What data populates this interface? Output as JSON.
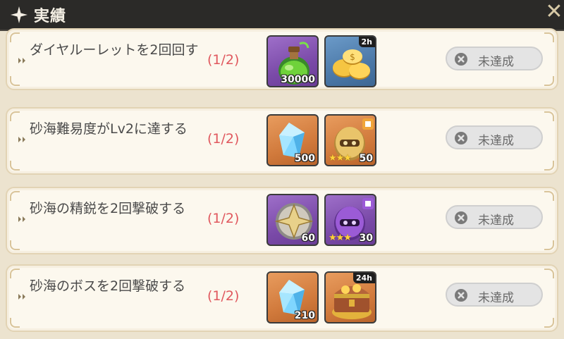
{
  "header": {
    "title": "実績",
    "close_glyph": "✕"
  },
  "achievements": [
    {
      "desc": "ダイヤルーレットを2回回す",
      "progress": "(1/2)",
      "status": "未達成",
      "rewards": [
        {
          "icon": "green-potion-icon",
          "bg": "purple",
          "qty": "30000",
          "time": "",
          "stars": ""
        },
        {
          "icon": "gold-coins-icon",
          "bg": "blue",
          "qty": "",
          "time": "2h",
          "stars": ""
        }
      ]
    },
    {
      "desc": "砂海難易度がLv2に達する",
      "progress": "(1/2)",
      "status": "未達成",
      "rewards": [
        {
          "icon": "blue-crystal-icon",
          "bg": "orange",
          "qty": "500",
          "time": "",
          "stars": ""
        },
        {
          "icon": "gold-helmet-icon",
          "bg": "orange",
          "qty": "50",
          "time": "",
          "stars": "★★★"
        }
      ]
    },
    {
      "desc": "砂海の精鋭を2回撃破する",
      "progress": "(1/2)",
      "status": "未達成",
      "rewards": [
        {
          "icon": "star-medal-icon",
          "bg": "purple",
          "qty": "60",
          "time": "",
          "stars": ""
        },
        {
          "icon": "purple-helmet-icon",
          "bg": "purple",
          "qty": "30",
          "time": "",
          "stars": "★★★"
        }
      ]
    },
    {
      "desc": "砂海のボスを2回撃破する",
      "progress": "(1/2)",
      "status": "未達成",
      "rewards": [
        {
          "icon": "blue-crystal-icon",
          "bg": "orange",
          "qty": "210",
          "time": "",
          "stars": ""
        },
        {
          "icon": "treasure-chest-icon",
          "bg": "orange",
          "qty": "",
          "time": "24h",
          "stars": ""
        }
      ]
    }
  ],
  "colors": {
    "header_bg": "#2b2a28",
    "progress": "#e0585e",
    "status_bg": "#e4e4e4",
    "panel_bg": "#fcf8ee"
  }
}
